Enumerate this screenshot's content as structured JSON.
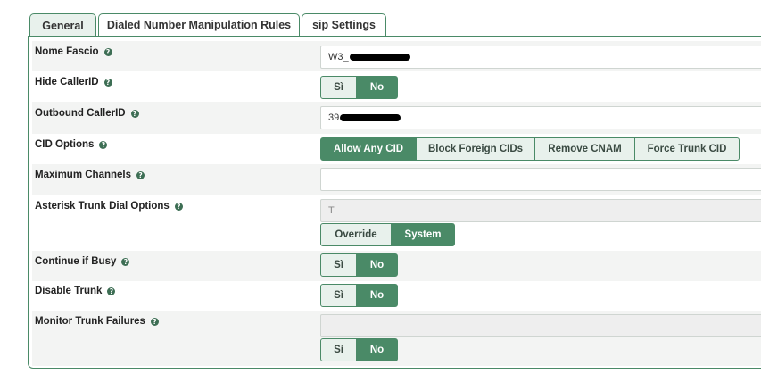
{
  "tabs": [
    {
      "label": "General"
    },
    {
      "label": "Dialed Number Manipulation Rules"
    },
    {
      "label": "sip Settings"
    }
  ],
  "help_glyph": "?",
  "fields": {
    "nome_fascio": {
      "label": "Nome Fascio",
      "value": "W3_"
    },
    "hide_callerid": {
      "label": "Hide CallerID",
      "options": [
        "Sì",
        "No"
      ],
      "selected": "No"
    },
    "outbound_callerid": {
      "label": "Outbound CallerID",
      "value": "39"
    },
    "cid_options": {
      "label": "CID Options",
      "options": [
        "Allow Any CID",
        "Block Foreign CIDs",
        "Remove CNAM",
        "Force Trunk CID"
      ],
      "selected": "Allow Any CID"
    },
    "maximum_channels": {
      "label": "Maximum Channels",
      "value": ""
    },
    "asterisk_dial_options": {
      "label": "Asterisk Trunk Dial Options",
      "value": "T",
      "options": [
        "Override",
        "System"
      ],
      "selected": "System"
    },
    "continue_if_busy": {
      "label": "Continue if Busy",
      "options": [
        "Sì",
        "No"
      ],
      "selected": "No"
    },
    "disable_trunk": {
      "label": "Disable Trunk",
      "options": [
        "Sì",
        "No"
      ],
      "selected": "No"
    },
    "monitor_trunk_failures": {
      "label": "Monitor Trunk Failures",
      "value": "",
      "options": [
        "Sì",
        "No"
      ],
      "selected": "No"
    }
  },
  "colors": {
    "accent": "#4a8a67",
    "accent_light": "#e8f1ec",
    "row_shade": "#f3f4f3"
  }
}
